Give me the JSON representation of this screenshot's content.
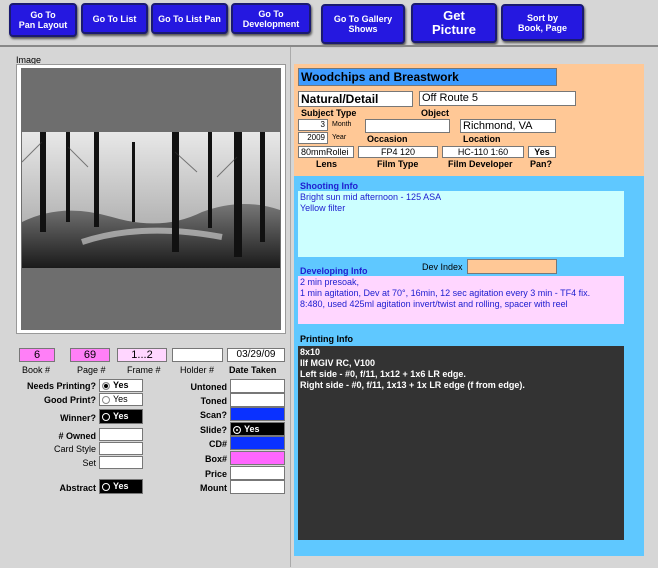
{
  "toolbar": {
    "go_to_pan_layout": "Go To\nPan Layout",
    "go_to_list": "Go To List",
    "go_to_list_pan": "Go To List Pan",
    "go_to_development": "Go To\nDevelopment",
    "go_to_gallery_shows": "Go To Gallery\nShows",
    "get_picture": "Get\nPicture",
    "sort_by_book_page": "Sort by\nBook, Page"
  },
  "image_label": "Image",
  "record": {
    "title": "Woodchips and Breastwork",
    "subject_type": "Natural/Detail",
    "subject_type_label": "Subject Type",
    "object": "Off Route 5",
    "object_label": "Object",
    "month": "3",
    "month_label": "Month",
    "year": "2009",
    "year_label": "Year",
    "occasion": "",
    "occasion_label": "Occasion",
    "location": "Richmond, VA",
    "location_label": "Location",
    "lens": "80mmRollei",
    "lens_label": "Lens",
    "film_type": "FP4 120",
    "film_type_label": "Film Type",
    "film_developer": "HC-110 1:60",
    "film_developer_label": "Film Developer",
    "pan": "Yes",
    "pan_label": "Pan?"
  },
  "shooting": {
    "label": "Shooting Info",
    "text": "Bright sun mid afternoon - 125 ASA\nYellow filter"
  },
  "developing": {
    "label": "Developing Info",
    "dev_index_label": "Dev Index",
    "dev_index": "",
    "text": "2 min presoak,\n1 min agitation,  Dev at 70°, 16min, 12 sec agitation every 3 min - TF4 fix.\n8:480, used 425ml agitation invert/twist and rolling, spacer with reel"
  },
  "printing": {
    "label": "Printing Info",
    "text": "8x10\nIlf MGIV RC, V100\nLeft side - #0, f/11, 1x12 + 1x6 LR edge.\nRight side - #0, f/11, 1x13 + 1x LR edge (f from edge)."
  },
  "catalog": {
    "book": "6",
    "book_label": "Book #",
    "page": "69",
    "page_label": "Page #",
    "frame": "1...2",
    "frame_label": "Frame #",
    "holder": "",
    "holder_label": "Holder #",
    "date_taken": "03/29/09",
    "date_taken_label": "Date Taken"
  },
  "flags": {
    "needs_printing_label": "Needs Printing?",
    "needs_printing": "Yes",
    "good_print_label": "Good Print?",
    "good_print": "Yes",
    "winner_label": "Winner?",
    "winner": "Yes",
    "owned_label": "# Owned",
    "owned": "",
    "card_style_label": "Card Style",
    "card_style": "",
    "set_label": "Set",
    "set": "",
    "abstract_label": "Abstract",
    "abstract": "Yes",
    "untoned_label": "Untoned",
    "untoned": "",
    "toned_label": "Toned",
    "toned": "",
    "scan_label": "Scan?",
    "scan": "",
    "slide_label": "Slide?",
    "slide": "Yes",
    "cd_label": "CD#",
    "cd": "",
    "box_label": "Box#",
    "box": "",
    "price_label": "Price",
    "price": "",
    "mount_label": "Mount",
    "mount": ""
  },
  "colors": {
    "button_blue": "#2518e0",
    "peach": "#ffc896",
    "sky": "#5fc8ff",
    "cyan_field": "#ccffff",
    "pink_field": "#ffd6ff",
    "print_bg": "#333333"
  }
}
